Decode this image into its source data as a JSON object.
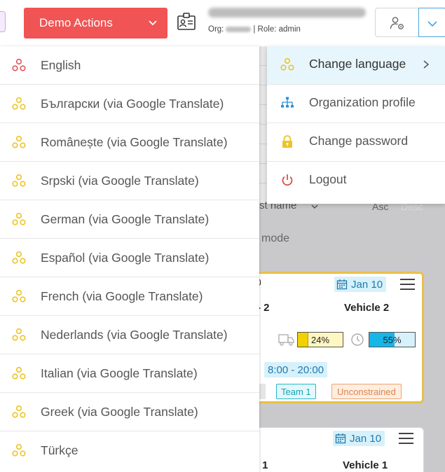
{
  "header": {
    "demo_actions_label": "Demo Actions",
    "org_prefix": "Org:",
    "role_text": "| Role: admin"
  },
  "language_menu": {
    "items": [
      {
        "label": "English",
        "icon": "language-icon",
        "current": true
      },
      {
        "label": "Български (via Google Translate)",
        "icon": "language-icon"
      },
      {
        "label": "Românește (via Google Translate)",
        "icon": "language-icon"
      },
      {
        "label": "Srpski (via Google Translate)",
        "icon": "language-icon"
      },
      {
        "label": "German (via Google Translate)",
        "icon": "language-icon"
      },
      {
        "label": "Español (via Google Translate)",
        "icon": "language-icon"
      },
      {
        "label": "French (via Google Translate)",
        "icon": "language-icon"
      },
      {
        "label": "Nederlands (via Google Translate)",
        "icon": "language-icon"
      },
      {
        "label": "Italian (via Google Translate)",
        "icon": "language-icon"
      },
      {
        "label": "Greek (via Google Translate)",
        "icon": "language-icon"
      },
      {
        "label": "Türkçe",
        "icon": "language-icon"
      }
    ]
  },
  "user_menu": {
    "items": [
      {
        "label": "Change language",
        "icon": "language-icon"
      },
      {
        "label": "Organization profile",
        "icon": "sitemap-icon"
      },
      {
        "label": "Change password",
        "icon": "lock-icon"
      },
      {
        "label": "Logout",
        "icon": "power-icon"
      }
    ]
  },
  "background": {
    "sort_label": "st name",
    "sort_asc": "Asc",
    "sort_desc": "Desc",
    "mode_label": "mode",
    "cards": [
      {
        "edge_char": "0",
        "date": "Jan 10",
        "route_num": "- 2",
        "vehicle": "Vehicle 2",
        "load_text": "24%",
        "load_fraction": 0.24,
        "time_text": "55%",
        "time_fraction": 0.55,
        "hours_edge": ")",
        "hours": "8:00 - 20:00",
        "team": "Team 1",
        "constraint": "Unconstrained"
      },
      {
        "edge_char": "7",
        "date": "Jan 10",
        "route_num": "- 1",
        "vehicle": "Vehicle 1"
      }
    ]
  },
  "colors": {
    "demo_red": "#f05454",
    "accent_blue": "#4aa3df",
    "language_yellow": "#ecc428",
    "language_red": "#e0555a",
    "logout_red": "#e0453f",
    "active_bg": "#e7f6fc"
  }
}
